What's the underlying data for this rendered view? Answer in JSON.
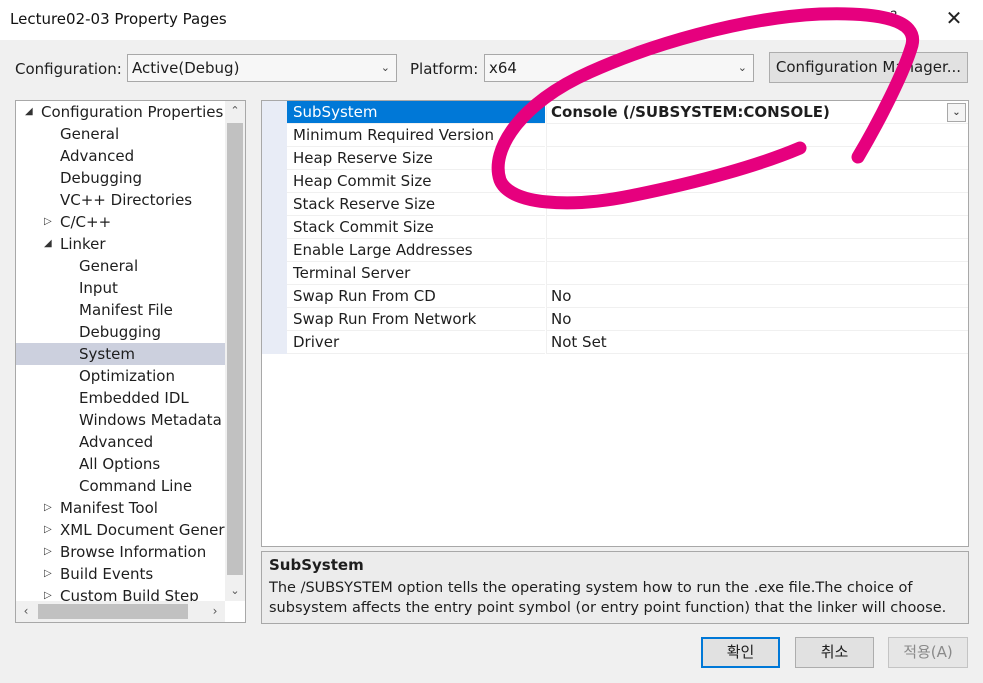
{
  "window": {
    "title": "Lecture02-03 Property Pages",
    "help": "?",
    "close": "✕"
  },
  "toolbar": {
    "configuration_label": "Configuration:",
    "configuration_value": "Active(Debug)",
    "platform_label": "Platform:",
    "platform_value": "x64",
    "config_manager_label": "Configuration Manager..."
  },
  "tree": {
    "items": [
      {
        "label": "Configuration Properties",
        "expander": "◢"
      },
      {
        "label": "General"
      },
      {
        "label": "Advanced"
      },
      {
        "label": "Debugging"
      },
      {
        "label": "VC++ Directories"
      },
      {
        "label": "C/C++",
        "expander": "▷"
      },
      {
        "label": "Linker",
        "expander": "◢"
      },
      {
        "label": "General"
      },
      {
        "label": "Input"
      },
      {
        "label": "Manifest File"
      },
      {
        "label": "Debugging"
      },
      {
        "label": "System"
      },
      {
        "label": "Optimization"
      },
      {
        "label": "Embedded IDL"
      },
      {
        "label": "Windows Metadata"
      },
      {
        "label": "Advanced"
      },
      {
        "label": "All Options"
      },
      {
        "label": "Command Line"
      },
      {
        "label": "Manifest Tool",
        "expander": "▷"
      },
      {
        "label": "XML Document Generat",
        "expander": "▷"
      },
      {
        "label": "Browse Information",
        "expander": "▷"
      },
      {
        "label": "Build Events",
        "expander": "▷"
      },
      {
        "label": "Custom Build Step",
        "expander": "▷"
      }
    ],
    "selected_index": 11
  },
  "properties": {
    "rows": [
      {
        "name": "SubSystem",
        "value": "Console (/SUBSYSTEM:CONSOLE)"
      },
      {
        "name": "Minimum Required Version",
        "value": ""
      },
      {
        "name": "Heap Reserve Size",
        "value": ""
      },
      {
        "name": "Heap Commit Size",
        "value": ""
      },
      {
        "name": "Stack Reserve Size",
        "value": ""
      },
      {
        "name": "Stack Commit Size",
        "value": ""
      },
      {
        "name": "Enable Large Addresses",
        "value": ""
      },
      {
        "name": "Terminal Server",
        "value": ""
      },
      {
        "name": "Swap Run From CD",
        "value": "No"
      },
      {
        "name": "Swap Run From Network",
        "value": "No"
      },
      {
        "name": "Driver",
        "value": "Not Set"
      }
    ],
    "selected_index": 0
  },
  "description": {
    "title": "SubSystem",
    "text": "The /SUBSYSTEM option tells the operating system how to run the .exe file.The choice of subsystem affects the entry point symbol (or entry point function) that the linker will choose."
  },
  "buttons": {
    "ok": "확인",
    "cancel": "취소",
    "apply": "적용(A)"
  },
  "colors": {
    "selection": "#0078d7",
    "tree_selection": "#ccd0de",
    "annotation": "#e6007e"
  },
  "icons": {
    "dropdown": "chevron-down-icon",
    "expand": "triangle-right-icon",
    "collapse": "triangle-down-icon"
  }
}
